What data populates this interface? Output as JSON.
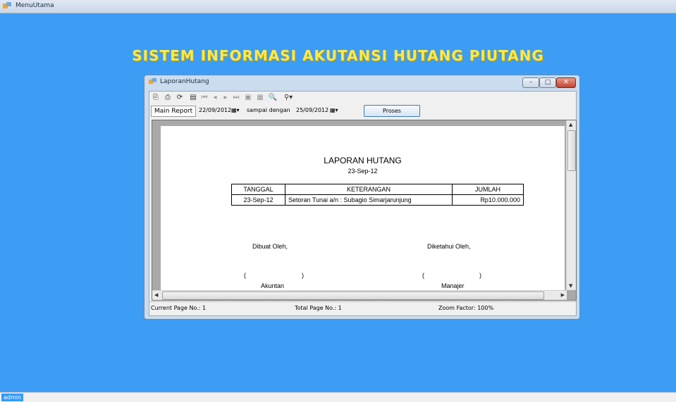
{
  "main_window": {
    "title": "MenuUtama"
  },
  "heading": "SISTEM INFORMASI AKUTANSI HUTANG PIUTANG",
  "child_window": {
    "title": "LaporanHutang",
    "minimize_glyph": "–",
    "maximize_glyph": "□",
    "close_glyph": "✕"
  },
  "toolbar": {
    "icons": [
      "export-icon",
      "print-icon",
      "refresh-icon",
      "tree-toggle-icon",
      "first-page-icon",
      "prev-page-icon",
      "next-page-icon",
      "last-page-icon",
      "goto-page-icon",
      "close-view-icon",
      "search-icon",
      "zoom-icon"
    ]
  },
  "params": {
    "tab_label": "Main Report",
    "start_date": "22/09/2012",
    "sampai_label": "sampai dengan",
    "end_date": "25/09/2012",
    "proses_label": "Proses"
  },
  "report": {
    "title": "LAPORAN HUTANG",
    "date": "23-Sep-12",
    "columns": [
      "TANGGAL",
      "KETERANGAN",
      "JUMLAH"
    ],
    "rows": [
      [
        "23-Sep-12",
        "Setoran Tunai a/n : Subagio Simarjarunjung",
        "Rp10.000.000"
      ]
    ],
    "dibuat_oleh": "Dibuat Oleh,",
    "diketahui_oleh": "Diketahui Oleh,",
    "paren_open": "(",
    "paren_close": ")",
    "signer_left_partial": "Akuntan",
    "signer_right_partial": "Manajer"
  },
  "status_bar": {
    "current_page": "Current Page No.: 1",
    "total_page": "Total Page No.: 1",
    "zoom": "Zoom Factor: 100%"
  },
  "user": "admin"
}
